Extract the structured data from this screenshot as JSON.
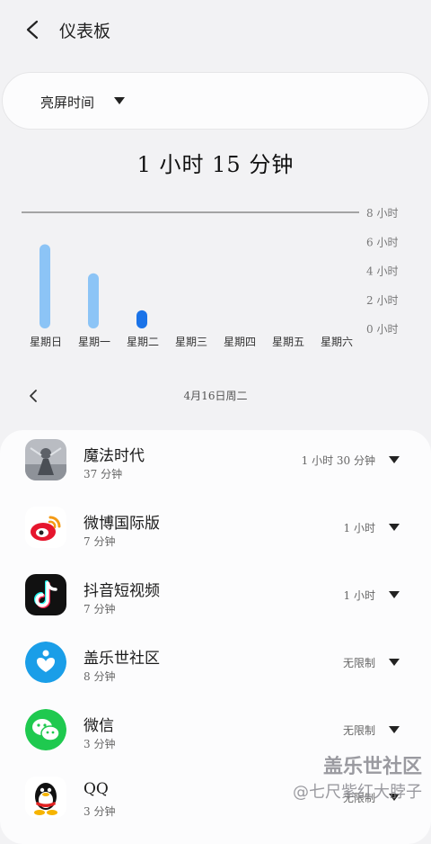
{
  "header": {
    "title": "仪表板"
  },
  "selector": {
    "label": "亮屏时间"
  },
  "summary": {
    "total_time": "1 小时 15 分钟"
  },
  "chart_data": {
    "type": "bar",
    "categories": [
      "星期日",
      "星期一",
      "星期二",
      "星期三",
      "星期四",
      "星期五",
      "星期六"
    ],
    "values": [
      5.8,
      3.8,
      1.25,
      0,
      0,
      0,
      0
    ],
    "y_tick_labels": [
      "8 小时",
      "6 小时",
      "4 小时",
      "2 小时",
      "0 小时"
    ],
    "ylim": [
      0,
      8
    ],
    "selected_index": 2,
    "colors": {
      "bar": "#8cc4f6",
      "selected": "#1a73e8",
      "axis": "#555555"
    }
  },
  "date_nav": {
    "date": "4月16日周二"
  },
  "apps": [
    {
      "name": "魔法时代",
      "usage": "37 分钟",
      "limit": "1 小时 30 分钟",
      "icon": "game-icon"
    },
    {
      "name": "微博国际版",
      "usage": "7 分钟",
      "limit": "1 小时",
      "icon": "weibo-icon"
    },
    {
      "name": "抖音短视频",
      "usage": "7 分钟",
      "limit": "1 小时",
      "icon": "douyin-icon"
    },
    {
      "name": "盖乐世社区",
      "usage": "8 分钟",
      "limit": "无限制",
      "icon": "galaxy-community-icon"
    },
    {
      "name": "微信",
      "usage": "3 分钟",
      "limit": "无限制",
      "icon": "wechat-icon"
    },
    {
      "name": "QQ",
      "usage": "3 分钟",
      "limit": "无限制",
      "icon": "qq-icon"
    }
  ],
  "watermark": {
    "line1": "盖乐世社区",
    "line2": "@七尺紫红大脖子"
  }
}
